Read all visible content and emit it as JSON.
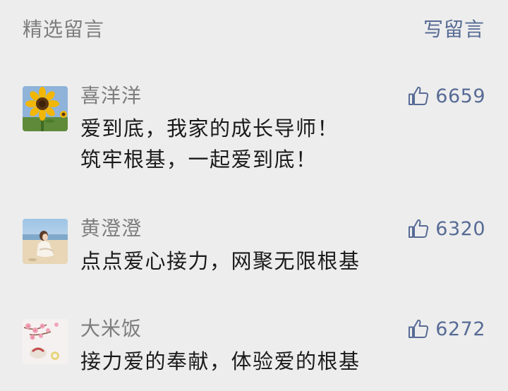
{
  "header": {
    "title": "精选留言",
    "write_label": "写留言"
  },
  "comments": [
    {
      "nickname": "喜洋洋",
      "likes": "6659",
      "avatar": "sunflower-avatar",
      "lines": [
        "爱到底，我家的成长导师！",
        "筑牢根基，一起爱到底！"
      ]
    },
    {
      "nickname": "黄澄澄",
      "likes": "6320",
      "avatar": "beach-girl-avatar",
      "lines": [
        "点点爱心接力，网聚无限根基"
      ]
    },
    {
      "nickname": "大米饭",
      "likes": "6272",
      "avatar": "cherry-blossom-avatar",
      "lines": [
        "接力爱的奉献，体验爱的根基"
      ]
    }
  ],
  "colors": {
    "background": "#ededed",
    "link": "#576b95",
    "muted": "#7d7d7d",
    "text": "#1a1a1a"
  }
}
